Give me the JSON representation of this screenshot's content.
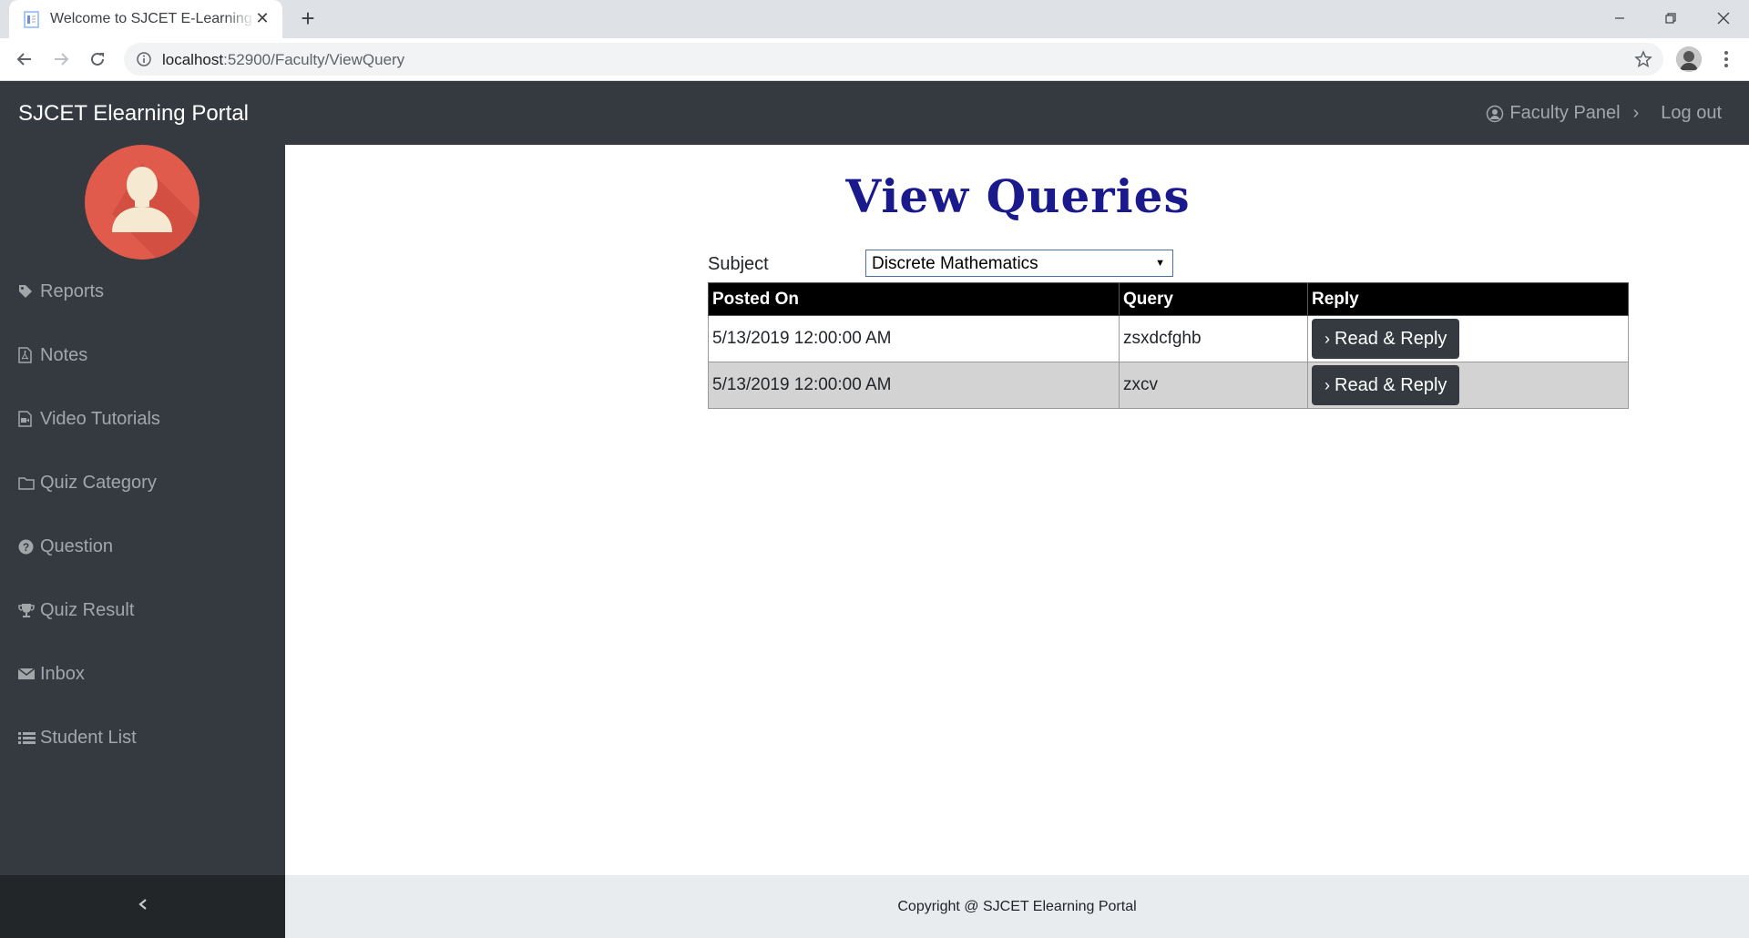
{
  "browser": {
    "tab_title": "Welcome to SJCET E-Learning Portal",
    "url_host": "localhost",
    "url_path": ":52900/Faculty/ViewQuery"
  },
  "navbar": {
    "brand": "SJCET Elearning Portal",
    "panel_label": "Faculty Panel",
    "logout_label": "Log out"
  },
  "sidebar": {
    "items": [
      {
        "label": "Reports",
        "icon": "tag-icon"
      },
      {
        "label": "Notes",
        "icon": "file-pdf-icon"
      },
      {
        "label": "Video Tutorials",
        "icon": "file-video-icon"
      },
      {
        "label": "Quiz Category",
        "icon": "folder-icon"
      },
      {
        "label": "Question",
        "icon": "question-circle-icon"
      },
      {
        "label": "Quiz Result",
        "icon": "trophy-icon"
      },
      {
        "label": "Inbox",
        "icon": "envelope-icon"
      },
      {
        "label": "Student List",
        "icon": "list-icon"
      }
    ]
  },
  "main": {
    "title": "View Queries",
    "subject_label": "Subject",
    "subject_value": "Discrete Mathematics",
    "table": {
      "headers": [
        "Posted On",
        "Query",
        "Reply"
      ],
      "rows": [
        {
          "posted_on": "5/13/2019 12:00:00 AM",
          "query": "zsxdcfghb",
          "reply_label": "Read & Reply"
        },
        {
          "posted_on": "5/13/2019 12:00:00 AM",
          "query": "zxcv",
          "reply_label": "Read & Reply"
        }
      ]
    }
  },
  "footer": {
    "copyright": "Copyright @ SJCET Elearning Portal"
  },
  "colors": {
    "navbar_bg": "#343a40",
    "avatar_bg": "#e05b4b",
    "title_color": "#1a1a8c",
    "footer_bg": "#e9ecef"
  }
}
